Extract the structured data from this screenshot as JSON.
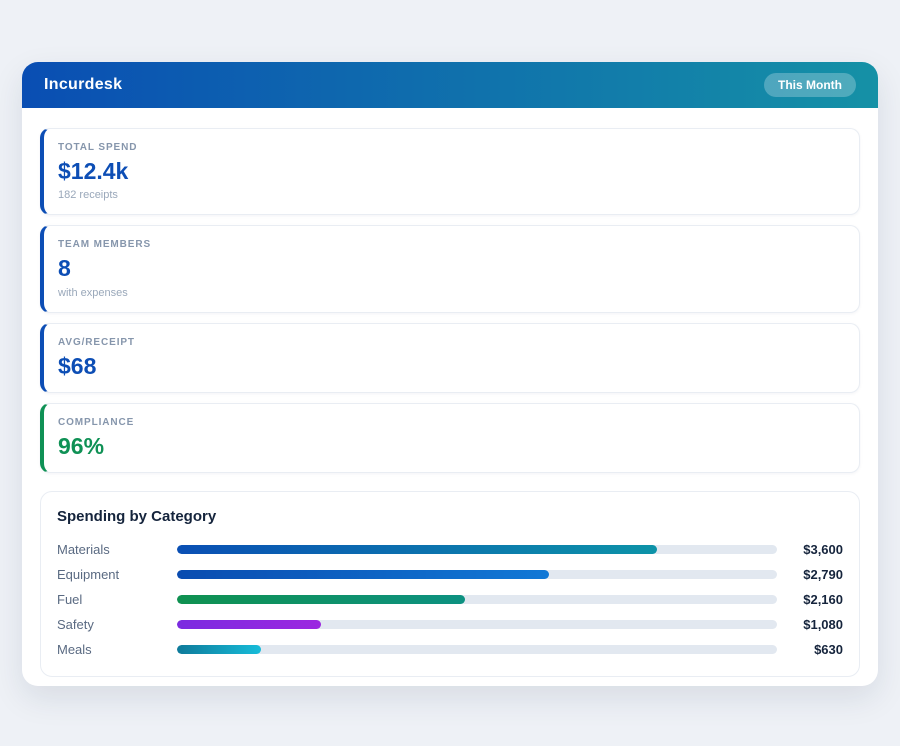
{
  "page": {
    "background": "#eef1f6"
  },
  "header": {
    "title": "Incurdesk",
    "badge": "This Month",
    "gradient_from": "#0a4eb3",
    "gradient_to": "#1591a6"
  },
  "stats": [
    {
      "label": "TOTAL SPEND",
      "value": "$12.4k",
      "sub": "182 receipts",
      "accent": "#0d4eb5",
      "value_color": "#0d4eb5"
    },
    {
      "label": "TEAM MEMBERS",
      "value": "8",
      "sub": "with expenses",
      "accent": "#0d4eb5",
      "value_color": "#0d4eb5"
    },
    {
      "label": "AVG/RECEIPT",
      "value": "$68",
      "sub": "",
      "accent": "#0d4eb5",
      "value_color": "#0d4eb5"
    },
    {
      "label": "COMPLIANCE",
      "value": "96%",
      "sub": "",
      "accent": "#0f9155",
      "value_color": "#0f9155"
    }
  ],
  "chart_data": {
    "type": "bar",
    "orientation": "horizontal",
    "title": "Spending by Category",
    "categories": [
      "Materials",
      "Equipment",
      "Fuel",
      "Safety",
      "Meals"
    ],
    "values": [
      3600,
      2790,
      2160,
      1080,
      630
    ],
    "value_labels": [
      "$3,600",
      "$2,790",
      "$2,160",
      "$1,080",
      "$630"
    ],
    "axis_max": 4500,
    "percents": [
      80,
      62,
      48,
      24,
      14
    ],
    "track_color": "#e2e8f0",
    "bar_gradients": [
      {
        "from": "#0a4fb4",
        "to": "#0d93a8"
      },
      {
        "from": "#0a4cb0",
        "to": "#1178d6"
      },
      {
        "from": "#0f9150",
        "to": "#0d9181"
      },
      {
        "from": "#7b2be0",
        "to": "#9c27e0"
      },
      {
        "from": "#0e7a9a",
        "to": "#17bcd9"
      }
    ],
    "grid": false,
    "legend": false
  }
}
